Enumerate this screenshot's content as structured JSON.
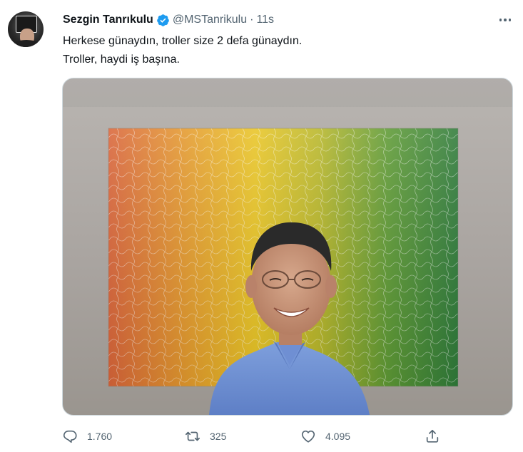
{
  "tweet": {
    "author": {
      "name": "Sezgin Tanrıkulu",
      "handle": "@MSTanrikulu",
      "verified": true,
      "verified_icon": "verified-badge-icon",
      "avatar_sign_text": "SAVAŞA HAYIR",
      "separator": "·",
      "time": "11s"
    },
    "text_lines": [
      "Herkese günaydın, troller size 2 defa günaydın.",
      "Troller, haydi iş başına."
    ],
    "media": {
      "type": "photo"
    },
    "actions": {
      "reply": {
        "icon": "reply-icon",
        "count": "1.760"
      },
      "retweet": {
        "icon": "retweet-icon",
        "count": "325"
      },
      "like": {
        "icon": "heart-icon",
        "count": "4.095"
      },
      "share": {
        "icon": "share-icon"
      }
    },
    "more_icon": "more-options-icon"
  },
  "colors": {
    "text_primary": "#0f1419",
    "text_secondary": "#536471",
    "verified_blue": "#1d9bf0",
    "border": "#cfd9de"
  }
}
